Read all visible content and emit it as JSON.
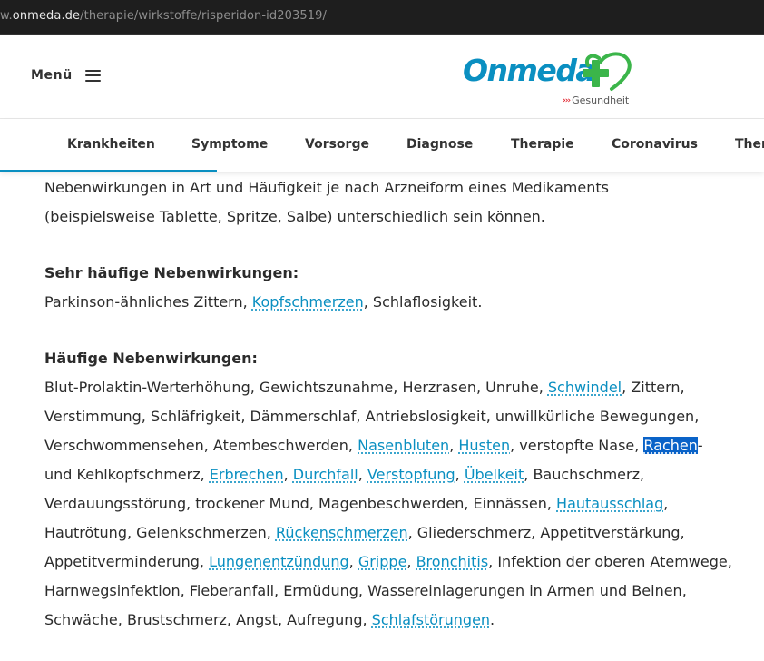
{
  "browser": {
    "url_scheme_prefix": "w.",
    "url_host": "onmeda.de",
    "url_path": "/therapie/wirkstoffe/risperidon-id203519/"
  },
  "header": {
    "menu_label": "Menü",
    "logo_text": "Onmeda",
    "logo_subtext": "Gesundheit",
    "colors": {
      "brand_blue": "#0a8fc1",
      "brand_green": "#3bb54a",
      "accent_red": "#e2232d"
    }
  },
  "nav": {
    "items": [
      {
        "label": "Krankheiten"
      },
      {
        "label": "Symptome"
      },
      {
        "label": "Vorsorge"
      },
      {
        "label": "Diagnose"
      },
      {
        "label": "Therapie"
      },
      {
        "label": "Coronavirus"
      },
      {
        "label": "Them"
      }
    ]
  },
  "article": {
    "intro_line1": "Nebenwirkungen in Art und Häufigkeit je nach Arzneiform eines Medikaments",
    "intro_line2": "(beispielsweise Tablette, Spritze, Salbe) unterschiedlich sein können.",
    "very_common": {
      "heading": "Sehr häufige Nebenwirkungen:",
      "t1": "Parkinson-ähnliches Zittern, ",
      "link_kopfschmerzen": "Kopfschmerzen",
      "t2": ", Schlaflosigkeit."
    },
    "common": {
      "heading": "Häufige Nebenwirkungen:",
      "t1": "Blut-Prolaktin-Werterhöhung, Gewichtszunahme, Herzrasen, Unruhe, ",
      "link_schwindel": "Schwindel",
      "t2": ", Zittern, Verstimmung, Schläfrigkeit, Dämmerschlaf, Antriebslosigkeit, unwillkürliche Bewegungen, Verschwommensehen, Atembeschwerden, ",
      "link_nasenbluten": "Nasenbluten",
      "t3": ", ",
      "link_husten": "Husten",
      "t4": ", verstopfte Nase, ",
      "link_rachen": "Rachen",
      "t5": "- und Kehlkopfschmerz, ",
      "link_erbrechen": "Erbrechen",
      "t6": ", ",
      "link_durchfall": "Durchfall",
      "t7": ", ",
      "link_verstopfung": "Verstopfung",
      "t8": ", ",
      "link_uebelkeit": "Übelkeit",
      "t9": ", Bauchschmerz, Verdauungsstörung, trockener Mund, Magenbeschwerden, Einnässen, ",
      "link_hautausschlag": "Hautausschlag",
      "t10": ", Hautrötung, Gelenkschmerzen, ",
      "link_rueckenschmerzen": "Rückenschmerzen",
      "t11": ", Gliederschmerz, Appetitverstärkung, Appetitverminderung, ",
      "link_lungenentzuendung": "Lungenentzündung",
      "t12": ", ",
      "link_grippe": "Grippe",
      "t13": ", ",
      "link_bronchitis": "Bronchitis",
      "t14": ", Infektion der oberen Atemwege, Harnwegsinfektion, Fieberanfall, Ermüdung, Wassereinlagerungen in Armen und Beinen, Schwäche, Brustschmerz, Angst, Aufregung, ",
      "link_schlafstoerungen": "Schlafstörungen",
      "t15": "."
    }
  }
}
